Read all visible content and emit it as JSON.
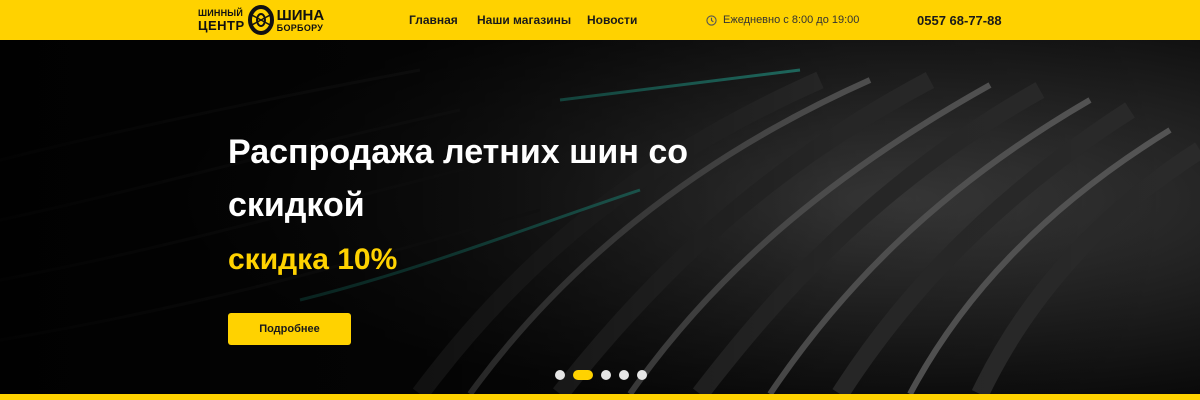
{
  "logo": {
    "left_line1": "ШИННЫЙ",
    "left_line2": "ЦЕНТР",
    "right_line1": "ШИНА",
    "right_line2": "БОРБОРУ"
  },
  "nav": {
    "home": "Главная",
    "stores": "Наши магазины",
    "news": "Новости"
  },
  "contact": {
    "hours": "Ежедневно с 8:00 до 19:00",
    "phone": "0557 68-77-88"
  },
  "hero": {
    "title": "Распродажа летних шин со скидкой",
    "discount": "скидка 10%",
    "button": "Подробнее"
  },
  "slider": {
    "count": 5,
    "active_index": 1
  },
  "colors": {
    "brand_yellow": "#ffd200",
    "dark": "#0a0a0a",
    "tread_accent": "#28b4a0"
  }
}
